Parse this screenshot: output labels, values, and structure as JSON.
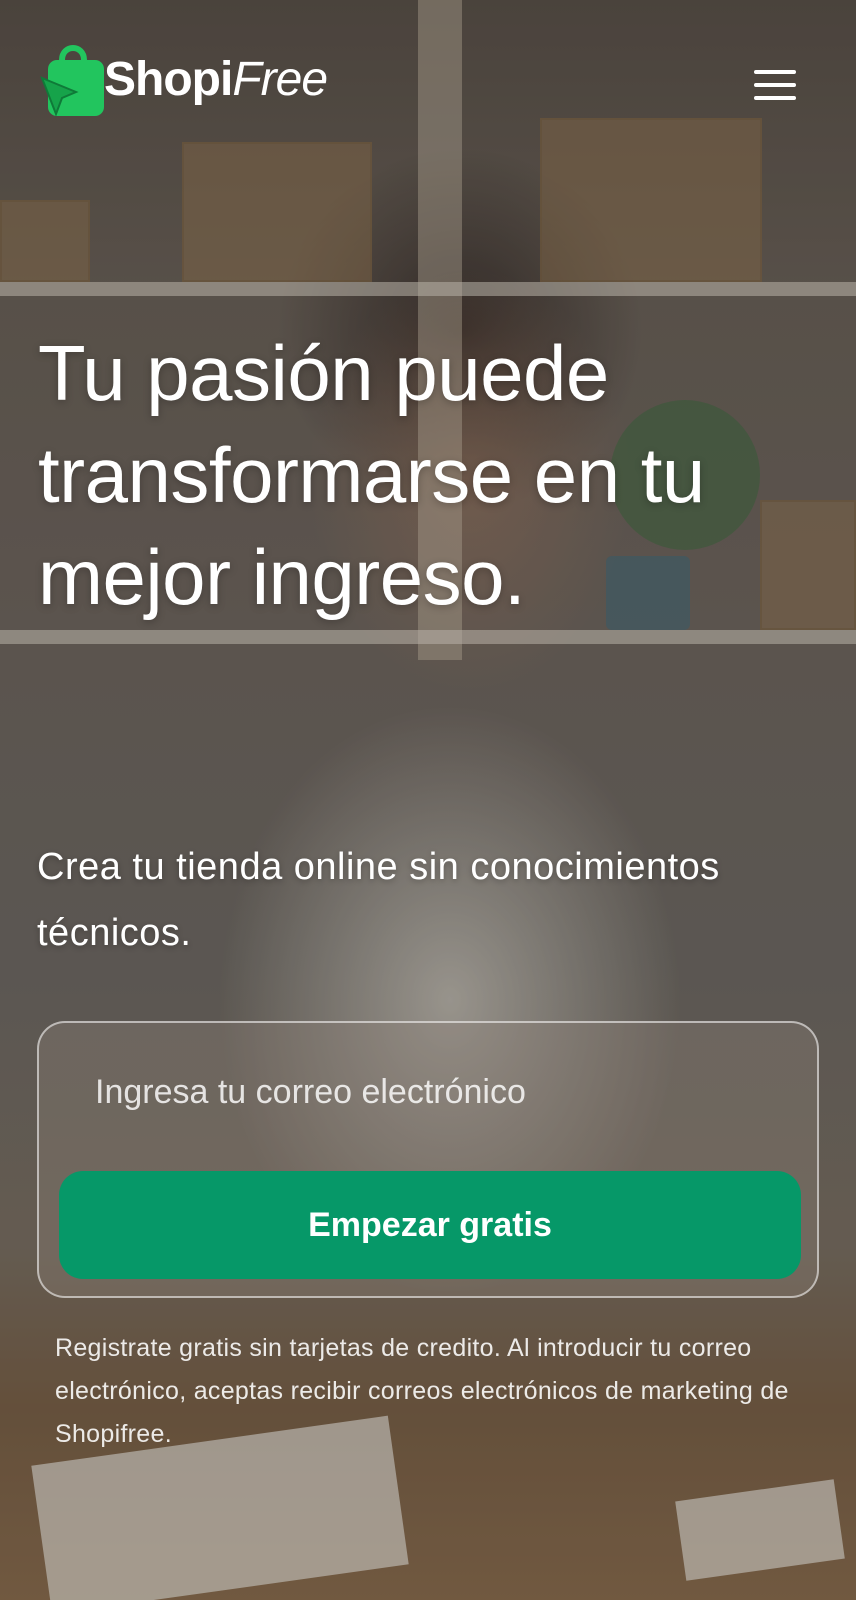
{
  "brand": {
    "name_part1": "Shopi",
    "name_part2": "Free",
    "accent_color": "#069868",
    "logo_icon": "shopping-bag-cursor-icon"
  },
  "header": {
    "menu_icon": "hamburger-menu-icon"
  },
  "hero": {
    "headline": "Tu pasión puede transformarse en tu mejor ingreso.",
    "subheadline": "Crea tu tienda online sin conocimientos técnicos."
  },
  "signup": {
    "email_placeholder": "Ingresa tu correo electrónico",
    "email_value": "",
    "cta_label": "Empezar gratis",
    "disclaimer": "Registrate gratis sin tarjetas de credito. Al introducir tu correo electrónico, aceptas recibir correos electrónicos de marketing de Shopifree."
  }
}
